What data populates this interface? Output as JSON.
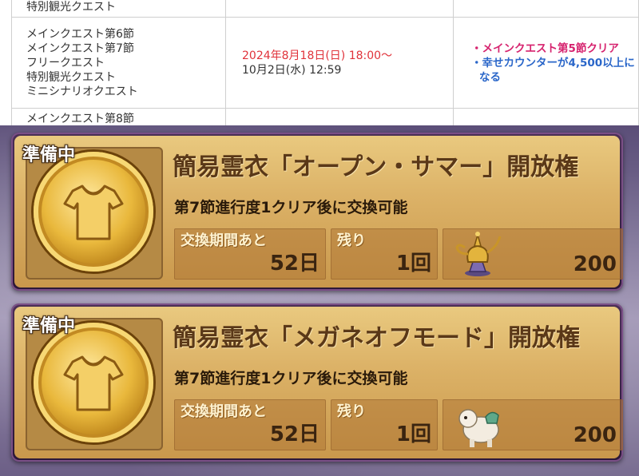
{
  "table": {
    "prev_row": {
      "col1": "特別観光クエスト"
    },
    "main_row": {
      "quests": [
        "メインクエスト第6節",
        "メインクエスト第7節",
        "フリークエスト",
        "特別観光クエスト",
        "ミニシナリオクエスト"
      ],
      "start": "2024年8月18日(日) 18:00〜",
      "end": "10月2日(水) 12:59",
      "conditions": [
        "・メインクエスト第5節クリア",
        "・幸せカウンターが4,500以上に",
        "なる"
      ]
    },
    "next_row": {
      "col1": "メインクエスト第8節"
    }
  },
  "cards": [
    {
      "badge": "準備中",
      "title": "簡易霊衣「オープン・サマー」開放権",
      "desc": "第7節進行度1クリア後に交換可能",
      "period_label": "交換期間あと",
      "period_value": "52日",
      "remain_label": "残り",
      "remain_value": "1回",
      "cost_icon": "golden-lamp-icon",
      "cost_value": "200"
    },
    {
      "badge": "準備中",
      "title": "簡易霊衣「メガネオフモード」開放権",
      "desc": "第7節進行度1クリア後に交換可能",
      "period_label": "交換期間あと",
      "period_value": "52日",
      "remain_label": "残り",
      "remain_value": "1回",
      "cost_icon": "camel-icon",
      "cost_value": "200"
    }
  ],
  "colors": {
    "start_date": "#e0323a",
    "condition_main": "#d6226e",
    "condition_counter": "#2a66c9"
  }
}
